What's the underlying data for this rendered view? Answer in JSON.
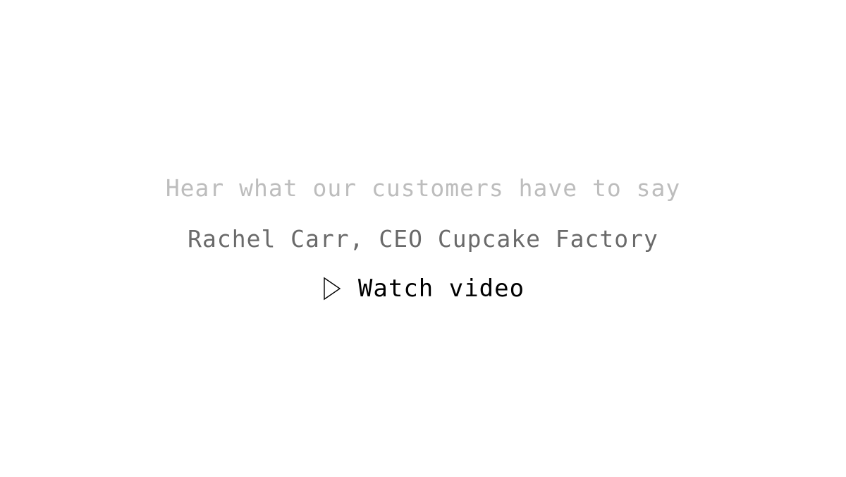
{
  "testimonial": {
    "heading": "Hear what our customers have to say",
    "author": "Rachel Carr, CEO Cupcake Factory",
    "watch_label": "Watch video",
    "play_icon": "play-outline-icon"
  },
  "colors": {
    "background": "#ffffff",
    "heading": "#bdbdbd",
    "author": "#6a6a6a",
    "action": "#000000"
  }
}
